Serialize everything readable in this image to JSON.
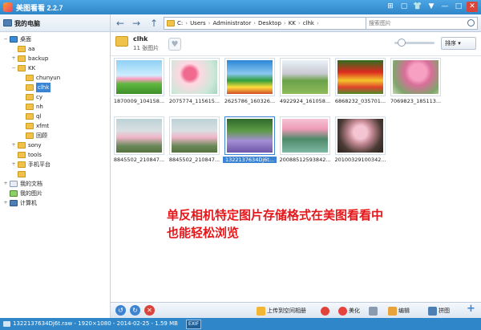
{
  "app": {
    "title": "美图看看 2.2.7"
  },
  "window_controls": [
    "⊞",
    "▢",
    "👕",
    "▼",
    "—",
    "□",
    "✕"
  ],
  "sidebar": {
    "header": "我的电脑",
    "items": [
      {
        "label": "桌面",
        "expander": "−"
      },
      {
        "label": "aa",
        "expander": ""
      },
      {
        "label": "backup",
        "expander": "+"
      },
      {
        "label": "KK",
        "expander": "−"
      },
      {
        "label": "chunyun",
        "expander": ""
      },
      {
        "label": "clhk",
        "expander": "",
        "selected": true
      },
      {
        "label": "cy",
        "expander": ""
      },
      {
        "label": "nh",
        "expander": ""
      },
      {
        "label": "ql",
        "expander": ""
      },
      {
        "label": "xfmt",
        "expander": ""
      },
      {
        "label": "回顾",
        "expander": ""
      },
      {
        "label": "sony",
        "expander": "+"
      },
      {
        "label": "tools",
        "expander": ""
      },
      {
        "label": "手机平台",
        "expander": "+"
      },
      {
        "label": "",
        "expander": ""
      },
      {
        "label": "我的文档",
        "expander": "+"
      },
      {
        "label": "我的图片",
        "expander": ""
      },
      {
        "label": "计算机",
        "expander": "+"
      }
    ]
  },
  "toolbar": {
    "back_icon": "←",
    "forward_icon": "→",
    "up_icon": "↑",
    "breadcrumb": [
      "C:",
      "Users",
      "Administrator",
      "Desktop",
      "KK",
      "clhk"
    ],
    "search_placeholder": "搜索图片"
  },
  "folder_info": {
    "name": "clhk",
    "count": "11 张图片",
    "heart_icon": "♥",
    "sort_label": "排序 ▾",
    "zoom_level": 0.1
  },
  "thumbnails": [
    {
      "caption": "1870009_104158...",
      "palette": "sky-field"
    },
    {
      "caption": "2075774_115615...",
      "palette": "blossom"
    },
    {
      "caption": "2625786_160326...",
      "palette": "meadow"
    },
    {
      "caption": "4922924_161058...",
      "palette": "park"
    },
    {
      "caption": "6868232_035701...",
      "palette": "tulips"
    },
    {
      "caption": "7069823_185113...",
      "palette": "pink-tree"
    },
    {
      "caption": "8845502_210847...",
      "palette": "mist-blossom"
    },
    {
      "caption": "8845502_210847...",
      "palette": "mist-blossom"
    },
    {
      "caption": "1322137634Dj6t...",
      "palette": "lavender",
      "selected": true
    },
    {
      "caption": "20088512593842...",
      "palette": "river"
    },
    {
      "caption": "20100329100342...",
      "palette": "dark-blossom"
    }
  ],
  "annotation": {
    "line1": "单反相机特定图片存储格式在美图看看中",
    "line2": "也能轻松浏览"
  },
  "bottombar": {
    "rotate_left_icon": "↺",
    "rotate_right_icon": "↻",
    "delete_icon": "✕",
    "upload_label": "上传到空间相册",
    "weibo_icon": "weibo-icon",
    "beautify_label": "美化",
    "edit_label": "编辑",
    "puzzle_label": "拼图",
    "add_icon": "+"
  },
  "status": {
    "text": "1322137634Dj6t.raw - 1920×1080 - 2014-02-25 - 1.59 MB",
    "exif": "EXIF"
  },
  "colors": {
    "titlebar": "#2f86c8",
    "selection": "#3b84d3",
    "annotation": "#e6171b"
  }
}
